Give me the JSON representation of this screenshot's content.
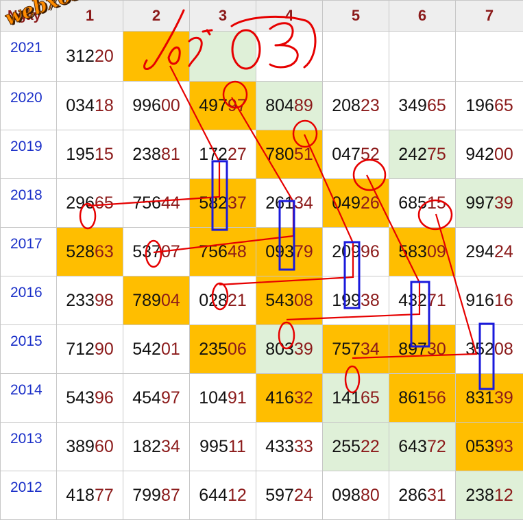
{
  "header": {
    "day_label": "Ngày",
    "columns": [
      "1",
      "2",
      "3",
      "4",
      "5",
      "6",
      "7"
    ]
  },
  "rows": [
    {
      "year": "2021",
      "cells": [
        "31220",
        "",
        "",
        "",
        "",
        "",
        ""
      ]
    },
    {
      "year": "2020",
      "cells": [
        "03418",
        "99600",
        "49797",
        "80489",
        "20823",
        "34965",
        "19665"
      ]
    },
    {
      "year": "2019",
      "cells": [
        "19515",
        "23881",
        "17227",
        "78051",
        "04752",
        "24275",
        "94200"
      ]
    },
    {
      "year": "2018",
      "cells": [
        "29665",
        "75644",
        "58237",
        "26134",
        "04926",
        "68515",
        "99739"
      ]
    },
    {
      "year": "2017",
      "cells": [
        "52863",
        "53707",
        "75648",
        "09379",
        "20996",
        "58309",
        "29424"
      ]
    },
    {
      "year": "2016",
      "cells": [
        "23398",
        "78904",
        "02821",
        "54308",
        "19938",
        "43271",
        "91616"
      ]
    },
    {
      "year": "2015",
      "cells": [
        "71290",
        "54201",
        "23506",
        "80339",
        "75734",
        "89730",
        "35208"
      ]
    },
    {
      "year": "2014",
      "cells": [
        "54396",
        "45497",
        "10491",
        "41632",
        "14165",
        "86156",
        "83139"
      ]
    },
    {
      "year": "2013",
      "cells": [
        "38960",
        "18234",
        "99511",
        "43333",
        "25522",
        "64372",
        "05393"
      ]
    },
    {
      "year": "2012",
      "cells": [
        "41877",
        "79987",
        "64412",
        "59724",
        "09880",
        "28631",
        "23812"
      ]
    }
  ],
  "highlights": {
    "orange": [
      [
        0,
        1
      ],
      [
        1,
        2
      ],
      [
        2,
        3
      ],
      [
        3,
        2
      ],
      [
        3,
        4
      ],
      [
        4,
        0
      ],
      [
        4,
        2
      ],
      [
        4,
        3
      ],
      [
        4,
        5
      ],
      [
        5,
        1
      ],
      [
        5,
        3
      ],
      [
        6,
        2
      ],
      [
        6,
        4
      ],
      [
        6,
        5
      ],
      [
        7,
        3
      ],
      [
        7,
        5
      ],
      [
        7,
        6
      ],
      [
        8,
        6
      ]
    ],
    "green": [
      [
        0,
        2
      ],
      [
        1,
        3
      ],
      [
        2,
        5
      ],
      [
        3,
        6
      ],
      [
        6,
        3
      ],
      [
        7,
        4
      ],
      [
        8,
        4
      ],
      [
        8,
        5
      ],
      [
        9,
        6
      ]
    ]
  },
  "watermark": "webxoso.net",
  "handwriting": "lô 03",
  "colors": {
    "orange": "#ffbe00",
    "green": "#dff0d8",
    "header_text": "#8b1a1a",
    "year_text": "#1a2fc8",
    "annotation_red": "#e60000",
    "annotation_blue": "#1a1adc"
  }
}
